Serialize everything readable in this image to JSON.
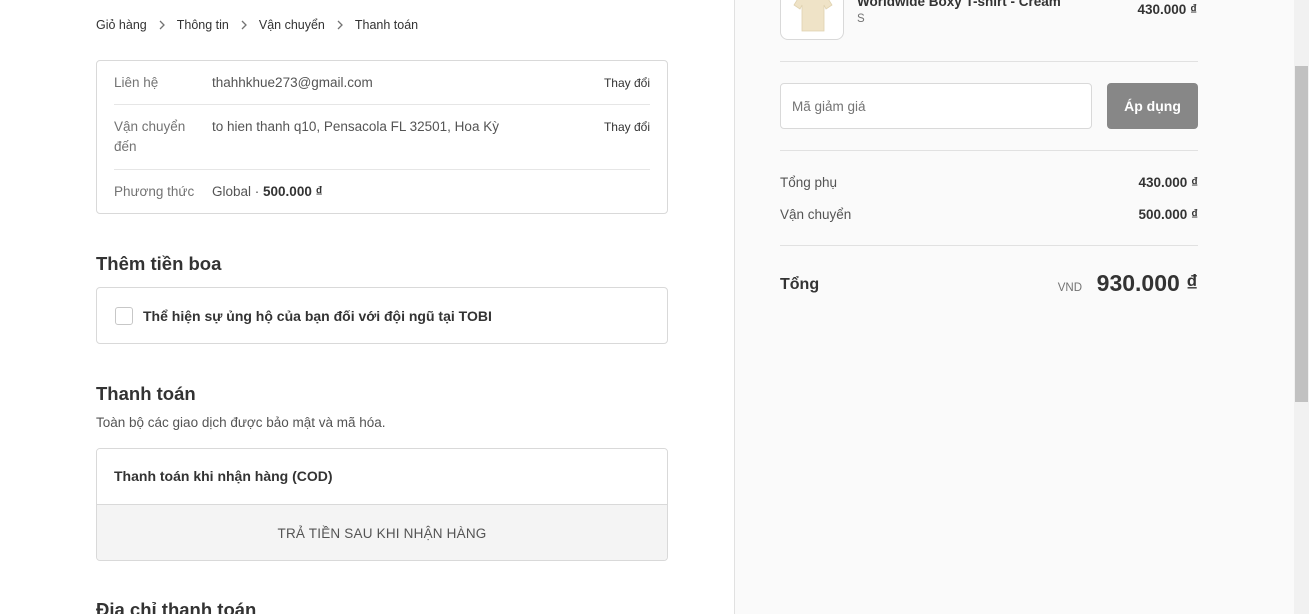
{
  "breadcrumb": {
    "items": [
      "Giỏ hàng",
      "Thông tin",
      "Vận chuyển",
      "Thanh toán"
    ]
  },
  "review": {
    "contact": {
      "label": "Liên hệ",
      "value": "thahhkhue273@gmail.com",
      "change": "Thay đổi"
    },
    "ship_to": {
      "label_line1": "Vận chuyển",
      "label_line2": "đến",
      "value": "to hien thanh q10, Pensacola FL 32501, Hoa Kỳ",
      "change": "Thay đổi"
    },
    "method": {
      "label": "Phương thức",
      "value_prefix": "Global · ",
      "value_price": "500.000 ₫"
    }
  },
  "tip": {
    "title": "Thêm tiền boa",
    "checkbox_label": "Thể hiện sự ủng hộ của bạn đối với đội ngũ tại TOBI",
    "checked": false
  },
  "payment": {
    "title": "Thanh toán",
    "subtitle": "Toàn bộ các giao dịch được bảo mật và mã hóa.",
    "method_name": "Thanh toán khi nhận hàng (COD)",
    "method_note": "TRẢ TIỀN SAU KHI NHẬN HÀNG"
  },
  "billing": {
    "title": "Địa chỉ thanh toán"
  },
  "sidebar": {
    "product": {
      "name": "Worldwide Boxy T-shirt - Cream",
      "variant": "S",
      "price": "430.000 ₫"
    },
    "discount": {
      "placeholder": "Mã giảm giá",
      "apply_label": "Áp dụng"
    },
    "subtotal": {
      "label": "Tổng phụ",
      "value": "430.000 ₫"
    },
    "shipping": {
      "label": "Vận chuyển",
      "value": "500.000 ₫"
    },
    "total": {
      "label": "Tổng",
      "currency": "VND",
      "value": "930.000 ₫"
    }
  },
  "colors": {
    "apply_button_bg": "#878787",
    "sidebar_bg": "#fafafa",
    "border": "#d9d9d9"
  },
  "icons": {
    "breadcrumb_separator": "chevron-right-icon",
    "product_image": "tshirt-icon"
  }
}
